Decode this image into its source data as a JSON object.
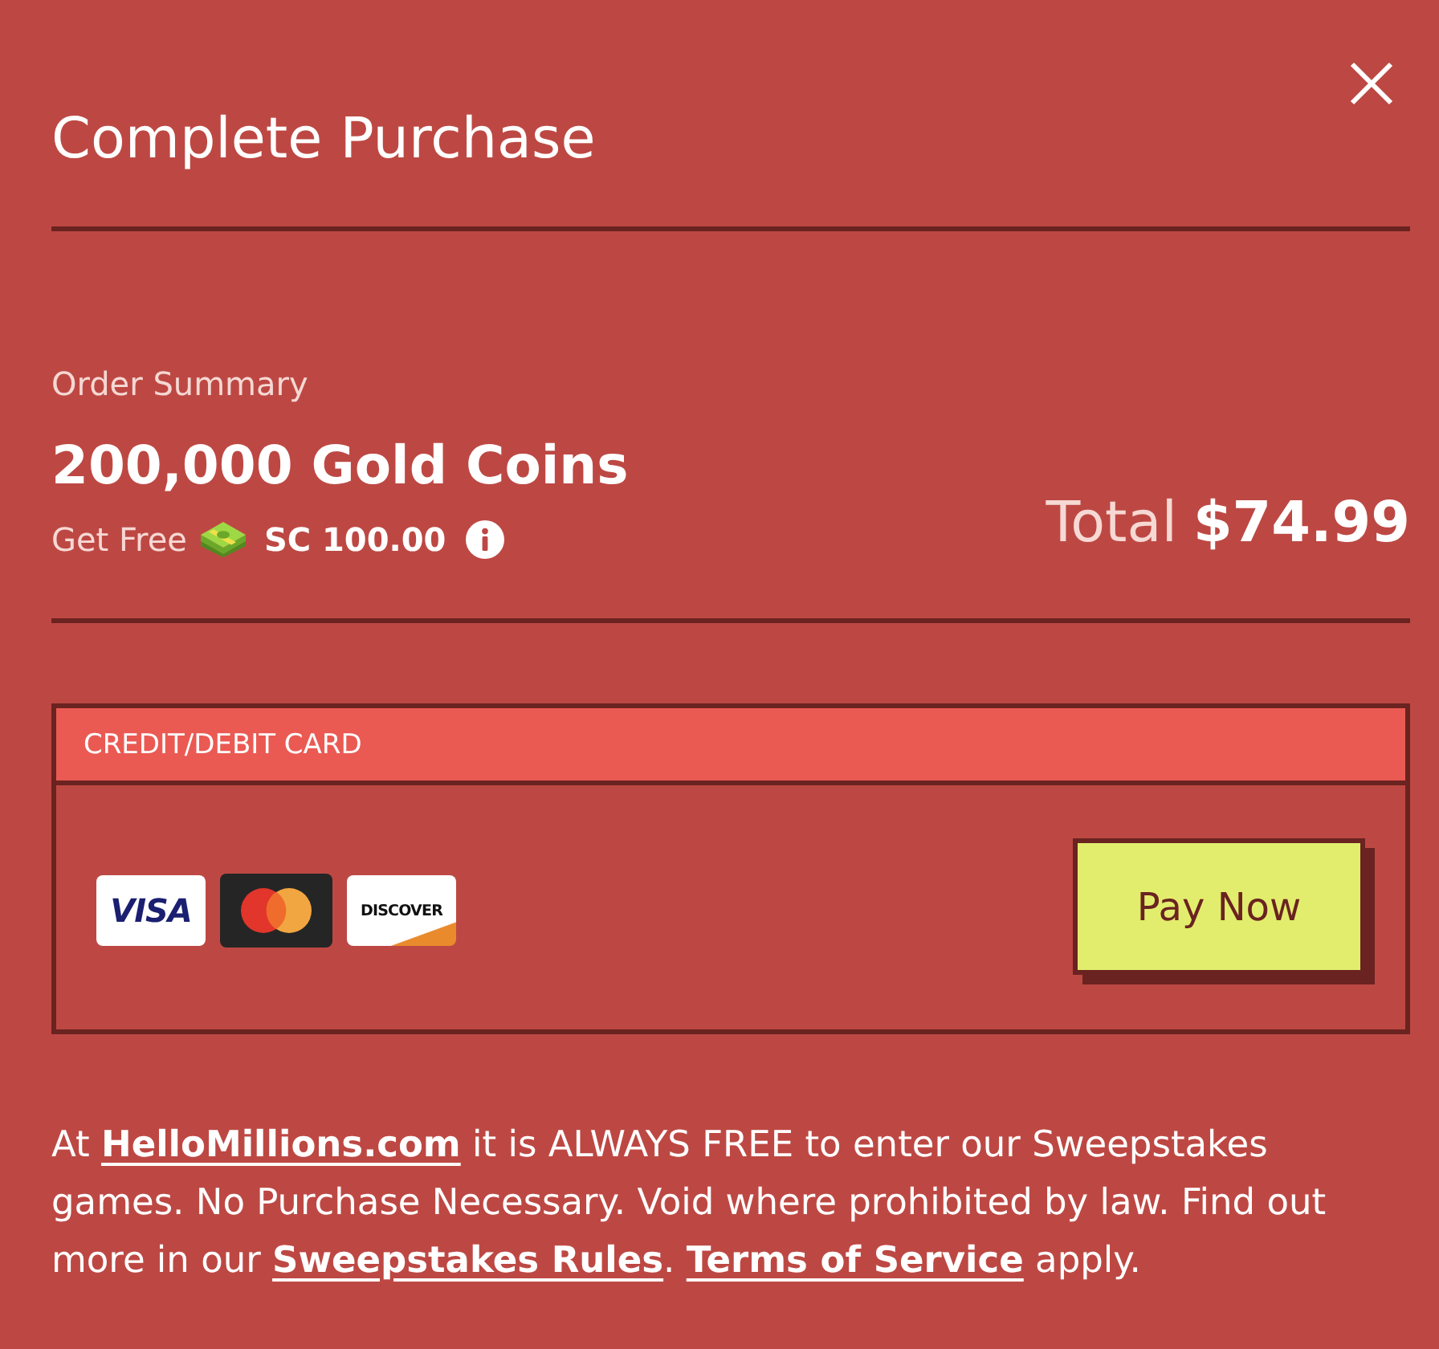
{
  "dialog": {
    "title": "Complete Purchase"
  },
  "order_summary": {
    "heading": "Order Summary",
    "product": "200,000 Gold Coins",
    "bonus_label": "Get Free",
    "bonus_amount": "SC 100.00"
  },
  "total": {
    "label": "Total",
    "amount": "$74.99"
  },
  "payment": {
    "method": "CREDIT/DEBIT CARD",
    "cards": [
      {
        "kind": "visa",
        "text": "VISA"
      },
      {
        "kind": "mastercard"
      },
      {
        "kind": "discover",
        "text": "DISCOVER"
      }
    ],
    "pay_button": "Pay Now"
  },
  "disclaimer": [
    {
      "kind": "text",
      "text": "At "
    },
    {
      "kind": "link",
      "text": "HelloMillions.com"
    },
    {
      "kind": "text",
      "text": " it is ALWAYS FREE to enter our Sweepstakes games. No Purchase Necessary. Void where prohibited by law. Find out more in our "
    },
    {
      "kind": "link",
      "text": "Sweepstakes Rules"
    },
    {
      "kind": "text",
      "text": ". "
    },
    {
      "kind": "link",
      "text": "Terms of Service"
    },
    {
      "kind": "text",
      "text": " apply."
    }
  ]
}
